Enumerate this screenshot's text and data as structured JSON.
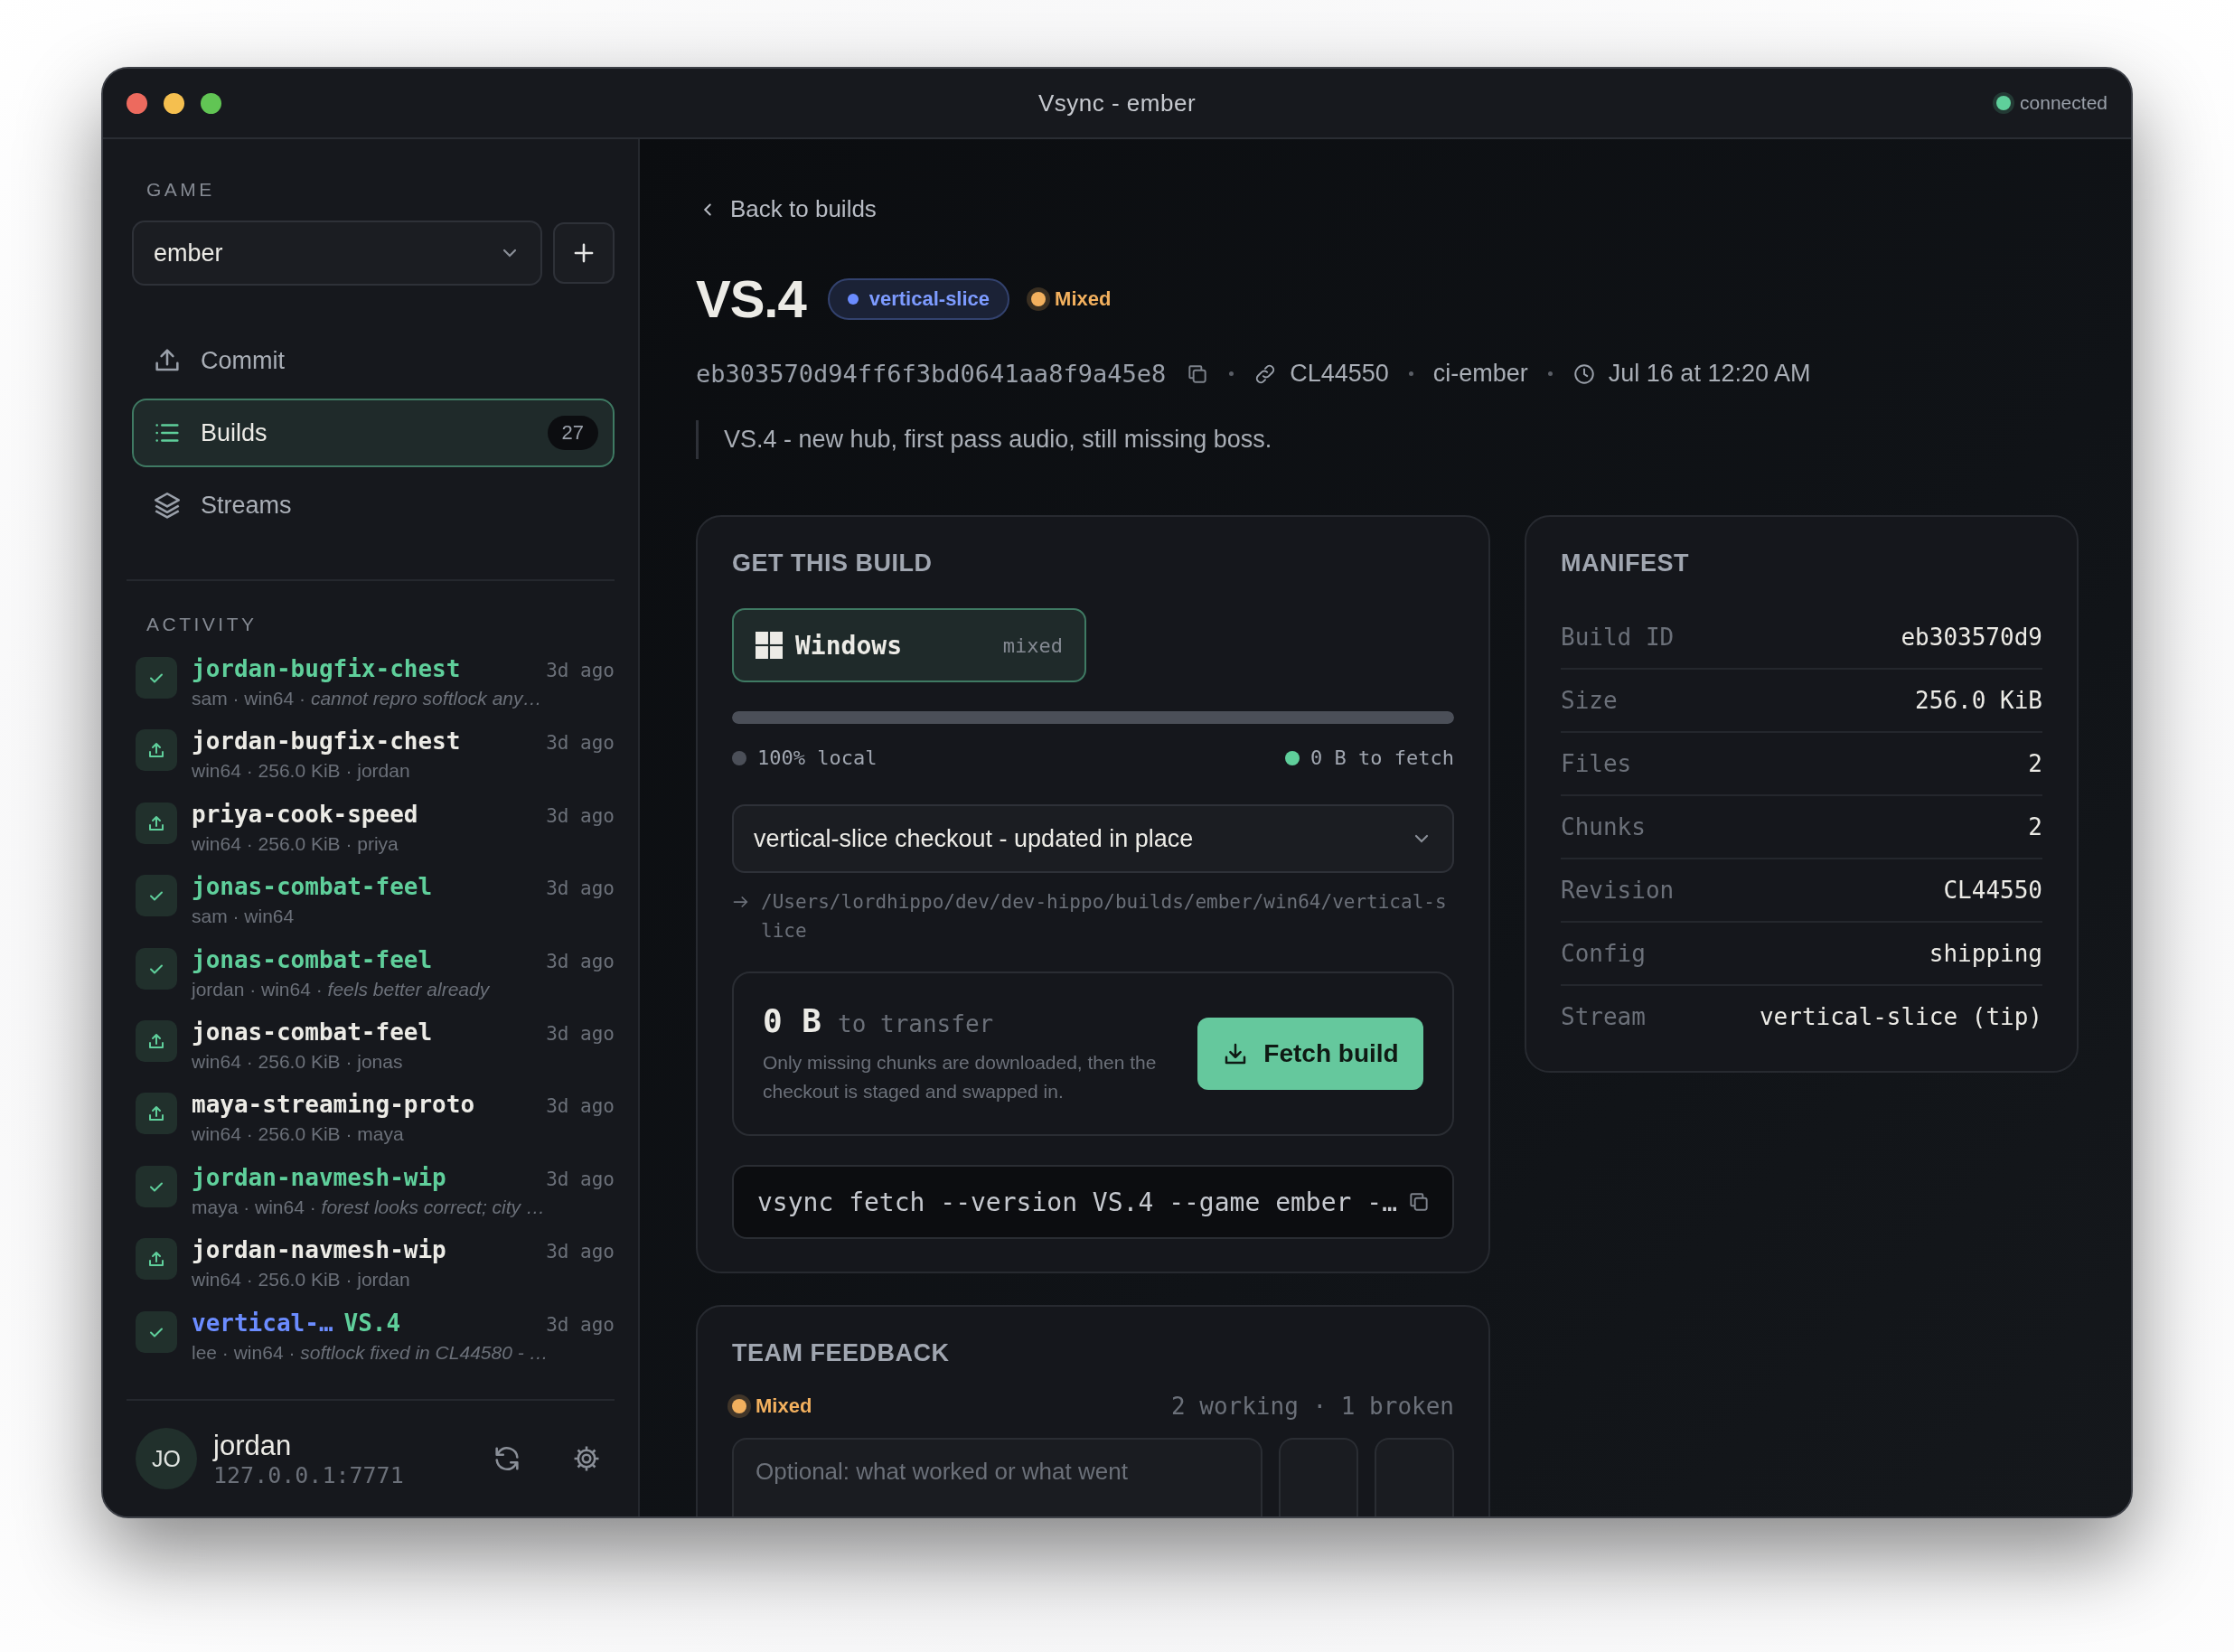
{
  "window": {
    "title": "Vsync - ember",
    "status": {
      "label": "connected",
      "online": true
    }
  },
  "sidebar": {
    "section_label": "GAME",
    "game": {
      "value": "ember"
    },
    "nav": [
      {
        "kind": "upload",
        "label": "Commit",
        "selected": false
      },
      {
        "kind": "list",
        "label": "Builds",
        "count": "27",
        "selected": true
      },
      {
        "kind": "layers",
        "label": "Streams",
        "selected": false
      }
    ],
    "activity_label": "ACTIVITY",
    "activity": [
      {
        "kind": "feedback",
        "name": "jordan-bugfix-chest",
        "meta": "sam · win64 · *cannot repro softlock any…*",
        "time": "3d ago"
      },
      {
        "kind": "upload",
        "name": "jordan-bugfix-chest",
        "meta": "win64 · 256.0 KiB · jordan",
        "time": "3d ago"
      },
      {
        "kind": "upload",
        "name": "priya-cook-speed",
        "meta": "win64 · 256.0 KiB · priya",
        "time": "3d ago"
      },
      {
        "kind": "feedback",
        "name": "jonas-combat-feel",
        "meta": "sam · win64",
        "time": "3d ago"
      },
      {
        "kind": "feedback",
        "name": "jonas-combat-feel",
        "meta": "jordan · win64 · *feels better already*",
        "time": "3d ago"
      },
      {
        "kind": "upload",
        "name": "jonas-combat-feel",
        "meta": "win64 · 256.0 KiB · jonas",
        "time": "3d ago"
      },
      {
        "kind": "upload",
        "name": "maya-streaming-proto",
        "meta": "win64 · 256.0 KiB · maya",
        "time": "3d ago"
      },
      {
        "kind": "feedback",
        "name": "jordan-navmesh-wip",
        "meta": "maya · win64 · *forest looks correct; city …*",
        "time": "3d ago"
      },
      {
        "kind": "upload",
        "name": "jordan-navmesh-wip",
        "meta": "win64 · 256.0 KiB · jordan",
        "time": "3d ago"
      },
      {
        "kind": "feedback",
        "stream": "vertical-…",
        "name": "VS.4",
        "meta": "lee · win64 · *softlock fixed in CL44580 - …*",
        "time": "3d ago"
      }
    ],
    "user": {
      "initials": "JO",
      "name": "jordan",
      "address": "127.0.0.1:7771"
    }
  },
  "main": {
    "back_link": "Back to builds",
    "build": {
      "version": "VS.4",
      "stream": "vertical-slice",
      "status": {
        "kind": "mixed",
        "label": "Mixed"
      },
      "hash": "eb303570d94ff6f3bd0641aa8f9a45e8",
      "revision": "CL44550",
      "author": "ci-ember",
      "date": "Jul 16 at 12:20 AM",
      "description": "VS.4 - new hub, first pass audio, still missing boss."
    },
    "get_build": {
      "title": "GET THIS BUILD",
      "platforms": [
        {
          "label": "Windows",
          "badge": "mixed",
          "selected": true
        }
      ],
      "progress": {
        "level": 1
      },
      "legend": [
        {
          "label": "100% local",
          "color": "#4b4f58"
        },
        {
          "label": "0 B to fetch",
          "color": "#5fcf9b"
        }
      ],
      "target": "vertical-slice checkout - updated in place",
      "path": "/Users/lordhippo/dev/dev-hippo/builds/ember/win64/vertical-slice",
      "transfer": {
        "amount": "0 B",
        "unit": "to transfer",
        "note": "Only missing chunks are downloaded, then the checkout is staged and swapped in."
      },
      "fetch_button": "Fetch build",
      "command": "vsync fetch --version VS.4 --game ember -…"
    },
    "manifest": {
      "title": "MANIFEST",
      "rows": [
        {
          "label": "Build ID",
          "value": "eb303570d9"
        },
        {
          "label": "Size",
          "value": "256.0 KiB"
        },
        {
          "label": "Files",
          "value": "2"
        },
        {
          "label": "Chunks",
          "value": "2"
        },
        {
          "label": "Revision",
          "value": "CL44550"
        },
        {
          "label": "Config",
          "value": "shipping"
        },
        {
          "label": "Stream",
          "value": "vertical-slice (tip)"
        }
      ]
    },
    "feedback": {
      "title": "TEAM FEEDBACK",
      "status": {
        "kind": "mixed",
        "label": "Mixed"
      },
      "summary": "2 working · 1 broken",
      "placeholder": "Optional: what worked or what went"
    }
  }
}
